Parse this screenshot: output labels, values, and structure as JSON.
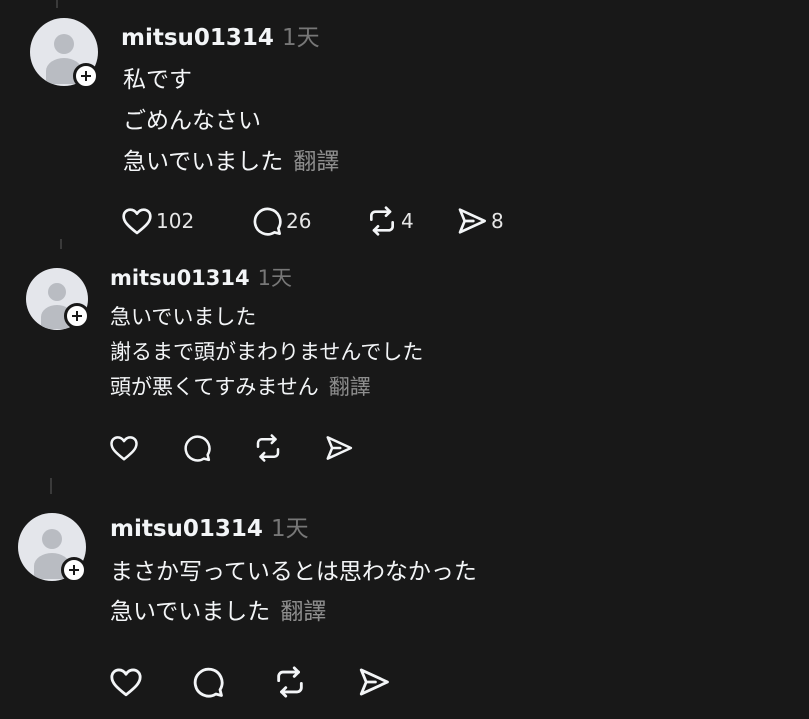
{
  "posts": [
    {
      "username": "mitsu01314",
      "time": "1天",
      "lines": [
        "私です",
        "ごめんなさい",
        "急いでいました"
      ],
      "translate_label": "翻譯",
      "counts": {
        "like": "102",
        "comment": "26",
        "repost": "4",
        "share": "8"
      }
    },
    {
      "username": "mitsu01314",
      "time": "1天",
      "lines": [
        "急いでいました",
        "謝るまで頭がまわりませんでした",
        "頭が悪くてすみません"
      ],
      "translate_label": "翻譯",
      "counts": {
        "like": "",
        "comment": "",
        "repost": "",
        "share": ""
      }
    },
    {
      "username": "mitsu01314",
      "time": "1天",
      "lines": [
        "まさか写っているとは思わなかった",
        "急いでいました"
      ],
      "translate_label": "翻譯",
      "counts": {
        "like": "",
        "comment": "",
        "repost": "",
        "share": ""
      }
    }
  ],
  "icons": {
    "like": "heart-icon",
    "comment": "speech-bubble-icon",
    "repost": "repost-arrows-icon",
    "share": "send-icon",
    "follow": "plus-icon",
    "avatar": "default-avatar-icon"
  },
  "colors": {
    "background": "#181818",
    "text": "#f3f5f7",
    "muted": "#777777",
    "translate": "#8e8e8e"
  }
}
